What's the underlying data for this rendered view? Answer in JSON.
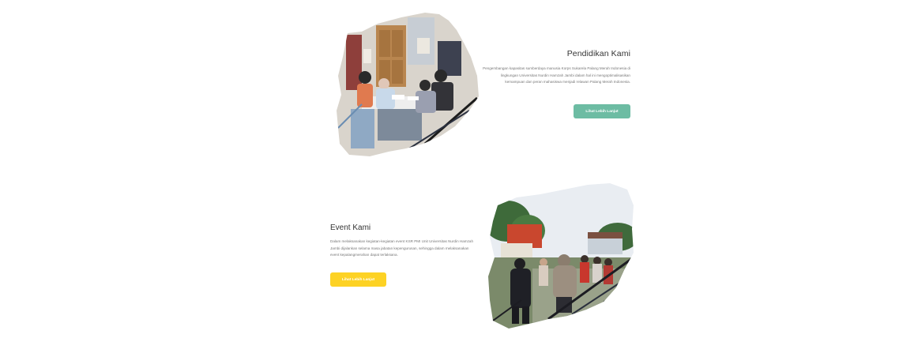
{
  "education": {
    "title": "Pendidikan Kami",
    "description": "Pengembangan kapasitas sumberdaya manusia Korps Sukarela Palang Merah Indonesia di lingkungan Universitas Nurdin Hamzah Jambi dalam hal ini mengoptimalisasikan kemampuan dan peran mahasiswa menjadi relawan Palang Merah Indonesia.",
    "button_label": "Lihat Lebih Lanjut",
    "button_color": "#6dbca3"
  },
  "event": {
    "title": "Event Kami",
    "description": "Dalam melaksanakan kegiatan-kegiatan event KSR PMI Unit Universitas Nurdin Hamzah Jambi dijalankan selama masa jabatan kepengurusan, sehingga dalam melaksanakan event kepalangmerahan dapat terlaksana.",
    "button_label": "Lihat Lebih Lanjut",
    "button_color": "#fdd224"
  }
}
